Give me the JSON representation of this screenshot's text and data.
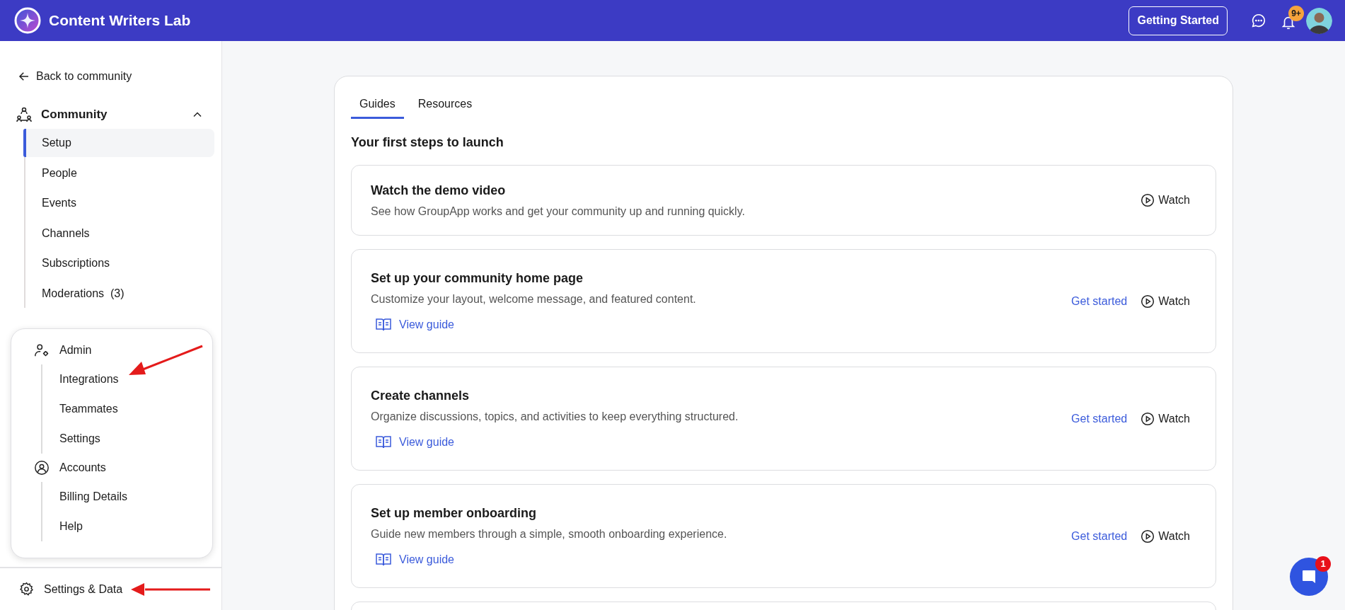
{
  "header": {
    "title": "Content Writers Lab",
    "button": "Getting Started",
    "notification_badge": "9+"
  },
  "sidebar": {
    "back_link": "Back to community",
    "section": {
      "title": "Community",
      "expanded": true,
      "items": [
        {
          "label": "Setup",
          "selected": true
        },
        {
          "label": "People",
          "selected": false
        },
        {
          "label": "Events",
          "selected": false
        },
        {
          "label": "Channels",
          "selected": false
        },
        {
          "label": "Subscriptions",
          "selected": false
        },
        {
          "label": "Moderations",
          "count": "(3)",
          "selected": false
        }
      ]
    },
    "popup_menu": {
      "groups": [
        {
          "title": "Admin",
          "kind": "admin",
          "items": [
            "Integrations",
            "Teammates",
            "Settings"
          ]
        },
        {
          "title": "Accounts",
          "kind": "accounts",
          "items": [
            "Billing Details",
            "Help"
          ]
        }
      ]
    },
    "footer_link": "Settings & Data"
  },
  "main": {
    "tabs": [
      {
        "label": "Guides",
        "selected": true
      },
      {
        "label": "Resources",
        "selected": false
      }
    ],
    "heading": "Your first steps to launch",
    "steps": [
      {
        "title": "Watch the demo video",
        "description": "See how GroupApp works and get your community up and running quickly.",
        "watch": "Watch"
      },
      {
        "title": "Set up your community home page",
        "description": "Customize your layout, welcome message, and featured content.",
        "guide_link": "View guide",
        "get_started": "Get started",
        "watch": "Watch"
      },
      {
        "title": "Create channels",
        "description": "Organize discussions, topics, and activities to keep everything structured.",
        "guide_link": "View guide",
        "get_started": "Get started",
        "watch": "Watch"
      },
      {
        "title": "Set up member onboarding",
        "description": "Guide new members through a simple, smooth onboarding experience.",
        "guide_link": "View guide",
        "get_started": "Get started",
        "watch": "Watch"
      }
    ]
  },
  "chat_badge": "1"
}
